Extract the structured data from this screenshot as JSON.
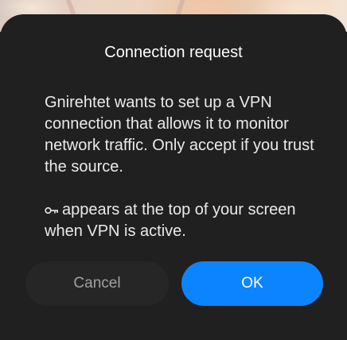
{
  "dialog": {
    "title": "Connection request",
    "message": "Gnirehtet wants to set up a VPN connection that allows it to monitor network traffic. Only accept if you trust the source.",
    "vpn_note": "appears at the top of your screen when VPN is active.",
    "vpn_note_icon": "key-icon",
    "cancel_label": "Cancel",
    "ok_label": "OK"
  },
  "colors": {
    "sheet_background": "#202020",
    "ok_button": "#0d84ff",
    "cancel_button": "#262626"
  }
}
